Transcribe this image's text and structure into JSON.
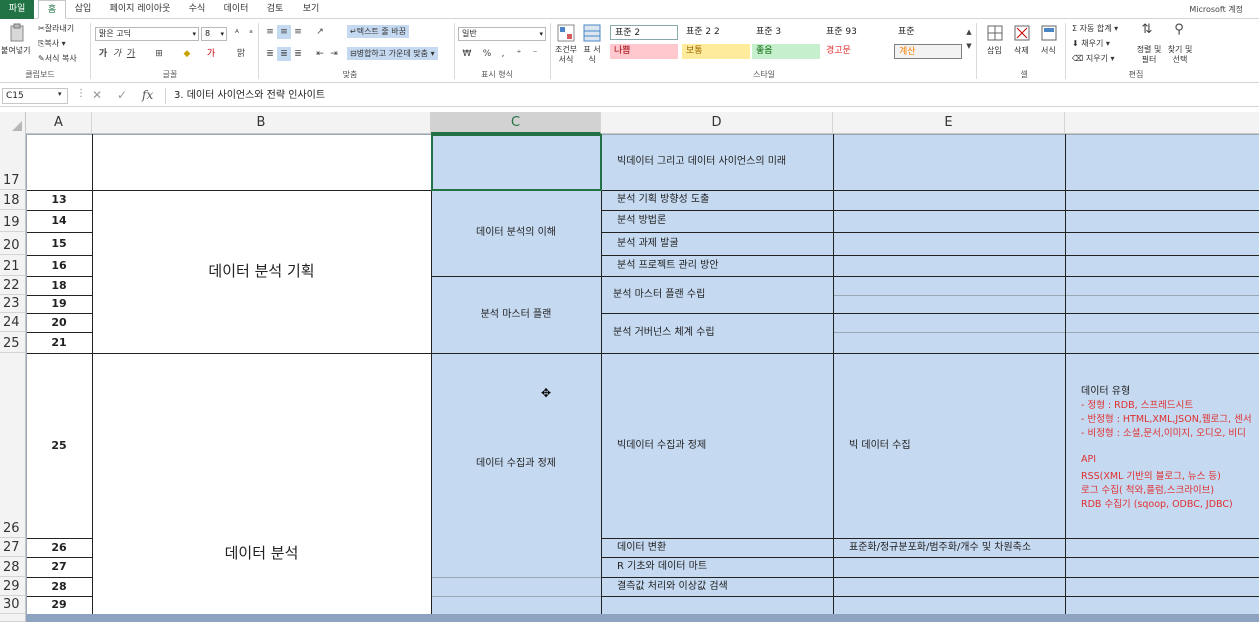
{
  "tabs": [
    "파일",
    "홈",
    "삽입",
    "페이지 레이아웃",
    "수식",
    "데이터",
    "검토",
    "보기"
  ],
  "account": "Microsoft 계정",
  "ribbon": {
    "clipboard": {
      "paste": "붙여넣기",
      "cut": "잘라내기",
      "copy": "복사",
      "format_painter": "서식 복사",
      "label": "클립보드"
    },
    "font": {
      "name": "맑은 고딕",
      "size": "8",
      "label": "글꼴"
    },
    "align": {
      "wrap": "텍스트 줄 바꿈",
      "merge": "병합하고 가운데 맞춤",
      "label": "맞춤"
    },
    "number": {
      "format": "일반",
      "label": "표시 형식"
    },
    "styles": {
      "cond": "조건부 서식",
      "table": "표 서식",
      "cells": [
        {
          "label": "표준 2",
          "bg": "#ffffff"
        },
        {
          "label": "표준 2 2",
          "bg": "#ffffff"
        },
        {
          "label": "표준 3",
          "bg": "#ffffff"
        },
        {
          "label": "표준 93",
          "bg": "#ffffff"
        },
        {
          "label": "표준",
          "bg": "#ffffff"
        },
        {
          "label": "나쁨",
          "bg": "#ffc7ce"
        },
        {
          "label": "보통",
          "bg": "#ffeb9c"
        },
        {
          "label": "좋음",
          "bg": "#c6efce"
        },
        {
          "label": "경고문",
          "bg": "#ffffff"
        },
        {
          "label": "계산",
          "bg": "#f2f2f2"
        }
      ],
      "label": "스타일"
    },
    "cells_group": {
      "insert": "삽입",
      "delete": "삭제",
      "format": "서식",
      "label": "셀"
    },
    "editing": {
      "autosum": "자동 합계",
      "fill": "채우기",
      "clear": "지우기",
      "sort": "정렬 및 필터",
      "find": "찾기 및 선택",
      "label": "편집"
    }
  },
  "formula_bar": {
    "name_box": "C15",
    "fx": "fx",
    "content": "3. 데이터 사이언스와 전략 인사이트"
  },
  "columns": [
    "A",
    "B",
    "C",
    "D",
    "E"
  ],
  "rows": {
    "headers": [
      "17",
      "18",
      "19",
      "20",
      "21",
      "22",
      "23",
      "24",
      "25",
      "26",
      "27",
      "28",
      "29",
      "30"
    ],
    "a_values": [
      "13",
      "14",
      "15",
      "16",
      "18",
      "19",
      "20",
      "21",
      "25",
      "26",
      "27",
      "28",
      "29"
    ]
  },
  "sheet": {
    "b_merge1": "데이터 분석 기획",
    "b_merge2": "데이터 분석",
    "c_1": "데이터 분석의 이해",
    "c_2": "분석 마스터 플랜",
    "c_3": "데이터 수집과 정제",
    "d_top": "빅데이터 그리고 데이터 사이언스의 미래",
    "d_rows": [
      "분석 기획 방향성 도출",
      "분석 방법론",
      "분석 과제 발굴",
      "분석 프로젝트 관리 방안"
    ],
    "d_master1": "분석 마스터 플랜 수립",
    "d_master2": "분석 거버넌스 체계 수립",
    "d_collect": "빅데이터 수집과 정제",
    "d_after": [
      "데이터 변환",
      "R 기초와 데이터 마트",
      "결측값 처리와 이상값 검색"
    ],
    "e_collect": "빅 데이터 수집",
    "e_transform": "표준화/정규분포화/범주화/개수 및 차원축소",
    "f_notes": {
      "title": "데이터 유형",
      "red_lines": [
        "- 정형 : RDB, 스프레드시트",
        "- 반정형 : HTML,XML,JSON,웹로그, 센서",
        "- 비정형 : 소셜,문서,이미지, 오디오, 비디"
      ],
      "api_lines": [
        "API",
        "RSS(XML 기반의 블로그, 뉴스 등)",
        "로그 수집( 척와,플럼,스크라이브)",
        "RDB 수집기 (sqoop, ODBC, JDBC)"
      ]
    }
  }
}
